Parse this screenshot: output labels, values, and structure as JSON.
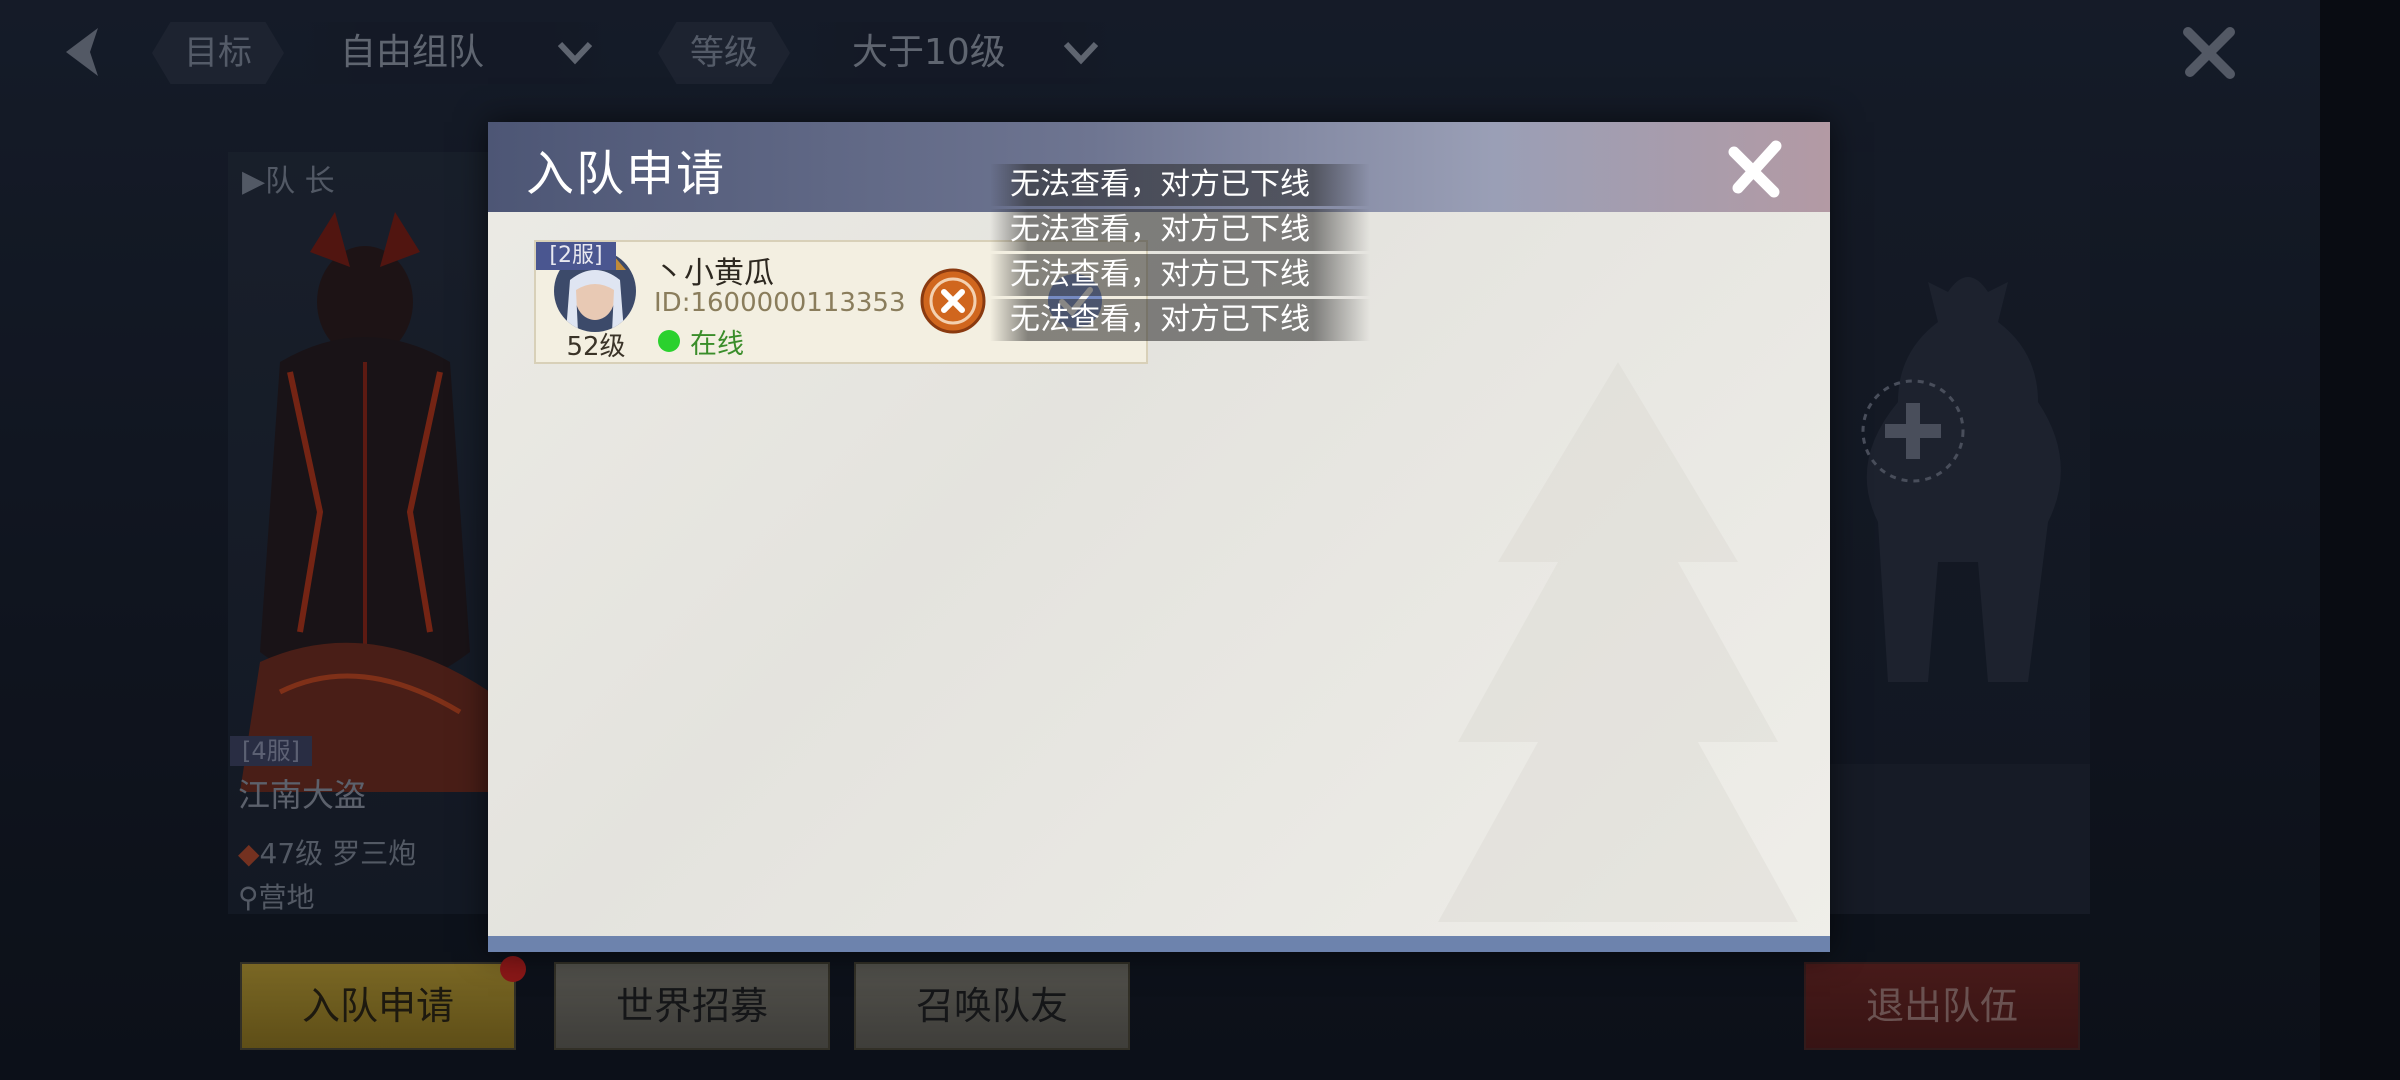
{
  "top_bar": {
    "target_label": "目标",
    "target_value": "自由组队",
    "level_label": "等级",
    "level_value": "大于10级"
  },
  "leader_card": {
    "leader_label": "队 长",
    "server": "[4服]",
    "name": "江南大盗",
    "class_info": "47级 罗三炮",
    "location": "营地"
  },
  "bottom_buttons": {
    "apply": "入队申请",
    "world_recruit": "世界招募",
    "summon": "召唤队友",
    "exit": "退出队伍"
  },
  "modal": {
    "title": "入队申请",
    "applicant": {
      "server": "[2服]",
      "name": "丶小黄瓜",
      "id": "ID:1600000113353",
      "level": "52级",
      "status": "在线"
    }
  },
  "toasts": [
    "无法查看，对方已下线",
    "无法查看，对方已下线",
    "无法查看，对方已下线",
    "无法查看，对方已下线"
  ],
  "colors": {
    "online": "#2bd12e",
    "apply_button": "#b89a30",
    "exit_button": "#6b2420",
    "reject": "#d0661e",
    "notification": "#d0201c"
  },
  "icons": [
    "back-arrow-icon",
    "chevron-down-icon",
    "close-icon",
    "plus-icon",
    "reject-x-icon",
    "accept-check-icon",
    "flame-icon",
    "location-pin-icon"
  ]
}
